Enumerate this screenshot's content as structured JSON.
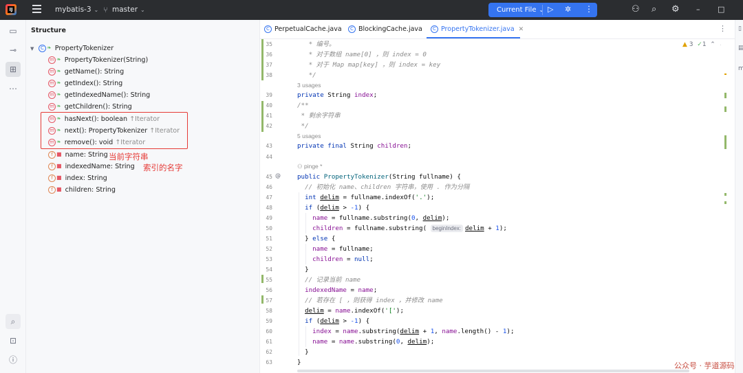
{
  "titlebar": {
    "project": "mybatis-3",
    "branch": "master",
    "run_config": "Current File"
  },
  "structure": {
    "title": "Structure",
    "root": "PropertyTokenizer",
    "members": [
      {
        "kind": "m",
        "access": "public",
        "label": "PropertyTokenizer(String)",
        "iface": ""
      },
      {
        "kind": "m",
        "access": "public",
        "label": "getName(): String",
        "iface": ""
      },
      {
        "kind": "m",
        "access": "public",
        "label": "getIndex(): String",
        "iface": ""
      },
      {
        "kind": "m",
        "access": "public",
        "label": "getIndexedName(): String",
        "iface": ""
      },
      {
        "kind": "m",
        "access": "public",
        "label": "getChildren(): String",
        "iface": ""
      },
      {
        "kind": "m",
        "access": "public",
        "label": "hasNext(): boolean",
        "iface": "↑Iterator"
      },
      {
        "kind": "m",
        "access": "public",
        "label": "next(): PropertyTokenizer",
        "iface": "↑Iterator"
      },
      {
        "kind": "m",
        "access": "public",
        "label": "remove(): void",
        "iface": "↑Iterator"
      },
      {
        "kind": "f",
        "access": "private",
        "label": "name: String",
        "iface": ""
      },
      {
        "kind": "f",
        "access": "private",
        "label": "indexedName: String",
        "iface": ""
      },
      {
        "kind": "f",
        "access": "private",
        "label": "index: String",
        "iface": ""
      },
      {
        "kind": "f",
        "access": "private",
        "label": "children: String",
        "iface": ""
      }
    ],
    "annotations": {
      "name_note": "当前字符串",
      "indexedName_note": "索引的名字"
    }
  },
  "tabs": [
    {
      "label": "PerpetualCache.java",
      "active": false
    },
    {
      "label": "BlockingCache.java",
      "active": false
    },
    {
      "label": "PropertyTokenizer.java",
      "active": true
    }
  ],
  "inspections": {
    "warnings": "3",
    "weak": "1"
  },
  "editor": {
    "line_numbers": [
      "35",
      "36",
      "37",
      "38",
      "39",
      "40",
      "41",
      "42",
      "43",
      "44",
      "45",
      "46",
      "47",
      "48",
      "49",
      "50",
      "51",
      "52",
      "53",
      "54",
      "55",
      "56",
      "57",
      "58",
      "59",
      "60",
      "61",
      "62",
      "63"
    ],
    "usage_hints": {
      "index": "3 usages",
      "children": "5 usages",
      "author": "pinge *"
    },
    "inlay_param": "beginIndex:"
  },
  "watermark": "公众号 · 芋道源码",
  "colors": {
    "accent": "#3574f0",
    "annotation": "#e53935",
    "vcs_modified": "#93b86a"
  }
}
